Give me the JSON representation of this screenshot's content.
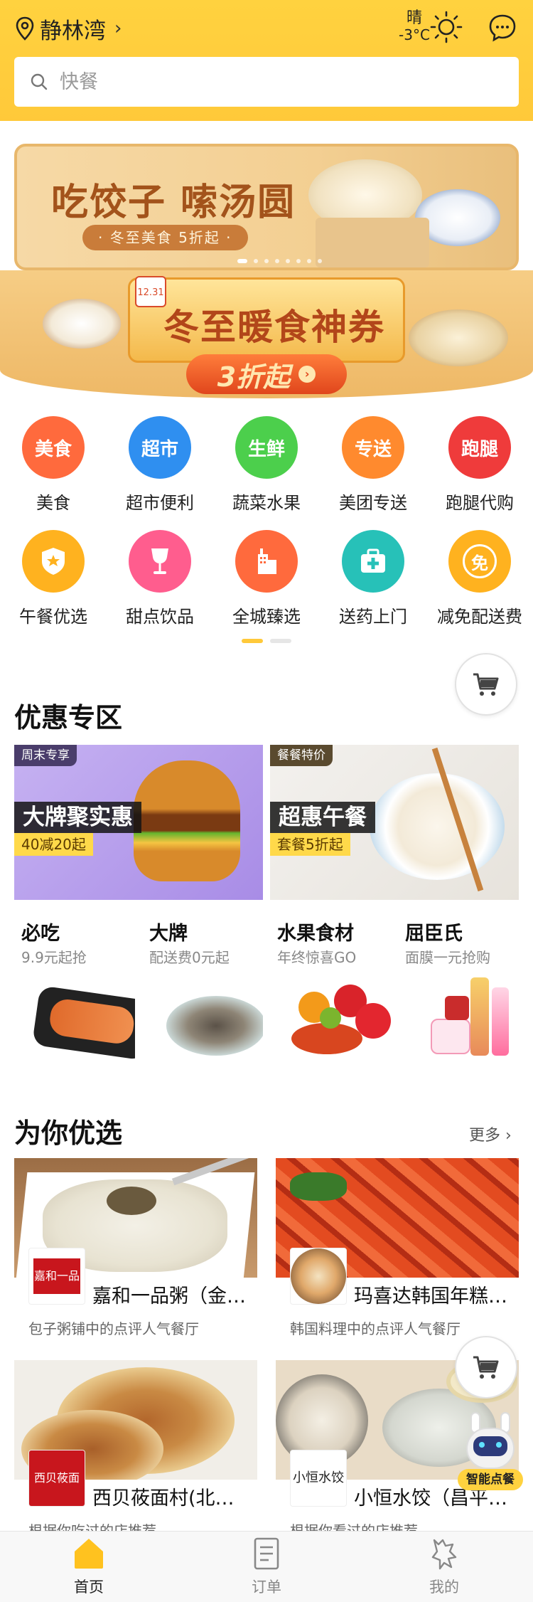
{
  "header": {
    "location": "静林湾",
    "weather_condition": "晴",
    "temperature": "-3°C",
    "search_placeholder": "快餐"
  },
  "banners": [
    {
      "headline": "吃饺子 嗦汤圆",
      "subline": "· 冬至美食 5折起 ·"
    },
    {
      "date_badge": "12.31",
      "headline": "冬至暖食神券",
      "button": "3折起"
    }
  ],
  "categories": [
    {
      "label": "美食",
      "icon_text": "美食",
      "color": "#ff6a3d"
    },
    {
      "label": "超市便利",
      "icon_text": "超市",
      "color": "#2f8ff0"
    },
    {
      "label": "蔬菜水果",
      "icon_text": "生鲜",
      "color": "#4ccf4c"
    },
    {
      "label": "美团专送",
      "icon_text": "专送",
      "color": "#ff8a2e"
    },
    {
      "label": "跑腿代购",
      "icon_text": "跑腿",
      "color": "#ef3b3b"
    },
    {
      "label": "午餐优选",
      "icon_text": "",
      "color": "#ffb21f"
    },
    {
      "label": "甜点饮品",
      "icon_text": "",
      "color": "#ff5d8e"
    },
    {
      "label": "全城臻选",
      "icon_text": "",
      "color": "#ff6a3d"
    },
    {
      "label": "送药上门",
      "icon_text": "",
      "color": "#27c1b8"
    },
    {
      "label": "减免配送费",
      "icon_text": "免",
      "color": "#ffb21f"
    }
  ],
  "deals": {
    "title": "优惠专区",
    "cards": [
      {
        "tag": "周末专享",
        "title": "大牌聚实惠",
        "subtitle": "40减20起"
      },
      {
        "tag": "餐餐特价",
        "title": "超惠午餐",
        "subtitle": "套餐5折起"
      }
    ],
    "minis": [
      {
        "title": "必吃",
        "subtitle": "9.9元起抢"
      },
      {
        "title": "大牌",
        "subtitle": "配送费0元起"
      },
      {
        "title": "水果食材",
        "subtitle": "年终惊喜GO"
      },
      {
        "title": "屈臣氏",
        "subtitle": "面膜一元抢购"
      }
    ]
  },
  "recommend": {
    "title": "为你优选",
    "more": "更多 ›",
    "stores": [
      {
        "name": "嘉和一品粥（金…",
        "desc": "包子粥铺中的点评人气餐厅",
        "logo_text": "嘉和一品"
      },
      {
        "name": "玛喜达韩国年糕…",
        "desc": "韩国料理中的点评人气餐厅",
        "logo_text": ""
      },
      {
        "name": "西贝莜面村(北…",
        "desc": "根据你吃过的店推荐",
        "logo_text": "西贝莜面村"
      },
      {
        "name": "小恒水饺（昌平…",
        "desc": "根据你看过的店推荐",
        "logo_text": "小恒水饺"
      }
    ]
  },
  "assistant": {
    "label": "智能点餐"
  },
  "nav": [
    {
      "label": "首页",
      "active": true
    },
    {
      "label": "订单",
      "active": false
    },
    {
      "label": "我的",
      "active": false
    }
  ]
}
